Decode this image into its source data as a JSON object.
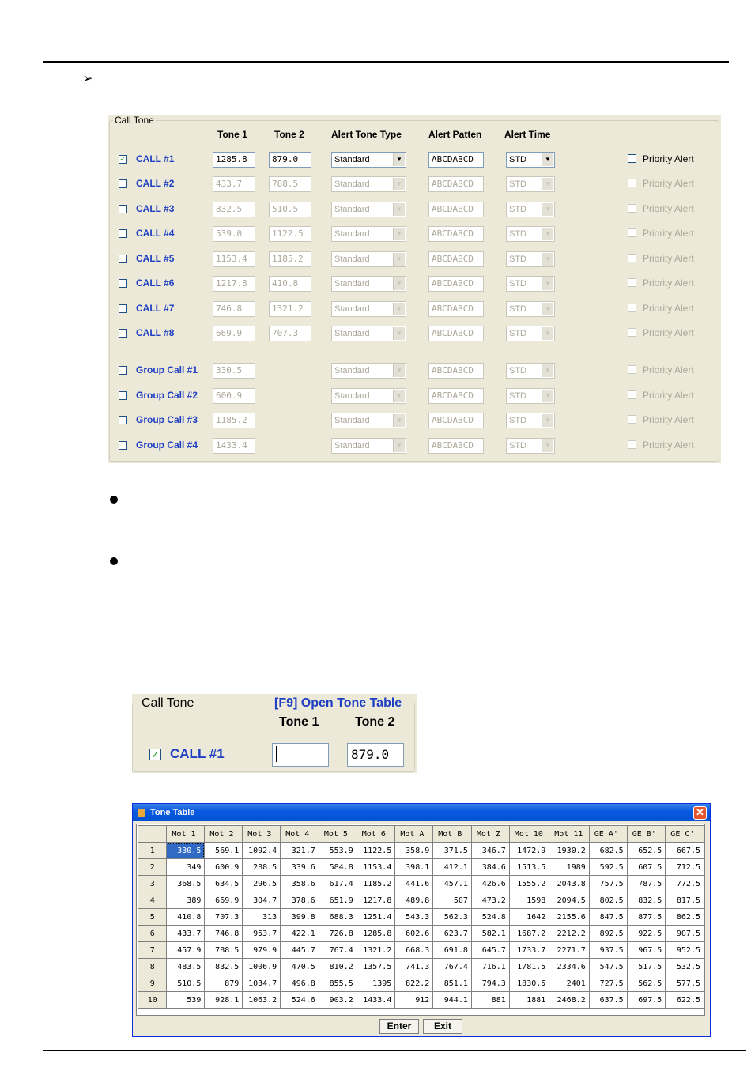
{
  "panel1": {
    "group_title": "Call Tone",
    "columns": [
      "Tone 1",
      "Tone 2",
      "Alert Tone Type",
      "Alert Patten",
      "Alert Time"
    ],
    "rows": [
      {
        "label": "CALL #1",
        "checked": true,
        "tone1": "1285.8",
        "tone2": "879.0",
        "type": "Standard",
        "pattern": "ABCDABCD",
        "time": "STD",
        "priority": "Priority Alert",
        "enabled": true
      },
      {
        "label": "CALL #2",
        "checked": false,
        "tone1": "433.7",
        "tone2": "788.5",
        "type": "Standard",
        "pattern": "ABCDABCD",
        "time": "STD",
        "priority": "Priority Alert",
        "enabled": false
      },
      {
        "label": "CALL #3",
        "checked": false,
        "tone1": "832.5",
        "tone2": "510.5",
        "type": "Standard",
        "pattern": "ABCDABCD",
        "time": "STD",
        "priority": "Priority Alert",
        "enabled": false
      },
      {
        "label": "CALL #4",
        "checked": false,
        "tone1": "539.0",
        "tone2": "1122.5",
        "type": "Standard",
        "pattern": "ABCDABCD",
        "time": "STD",
        "priority": "Priority Alert",
        "enabled": false
      },
      {
        "label": "CALL #5",
        "checked": false,
        "tone1": "1153.4",
        "tone2": "1185.2",
        "type": "Standard",
        "pattern": "ABCDABCD",
        "time": "STD",
        "priority": "Priority Alert",
        "enabled": false
      },
      {
        "label": "CALL #6",
        "checked": false,
        "tone1": "1217.8",
        "tone2": "410.8",
        "type": "Standard",
        "pattern": "ABCDABCD",
        "time": "STD",
        "priority": "Priority Alert",
        "enabled": false
      },
      {
        "label": "CALL #7",
        "checked": false,
        "tone1": "746.8",
        "tone2": "1321.2",
        "type": "Standard",
        "pattern": "ABCDABCD",
        "time": "STD",
        "priority": "Priority Alert",
        "enabled": false
      },
      {
        "label": "CALL #8",
        "checked": false,
        "tone1": "669.9",
        "tone2": "707.3",
        "type": "Standard",
        "pattern": "ABCDABCD",
        "time": "STD",
        "priority": "Priority Alert",
        "enabled": false
      }
    ],
    "group_rows": [
      {
        "label": "Group Call #1",
        "checked": false,
        "tone1": "330.5",
        "type": "Standard",
        "pattern": "ABCDABCD",
        "time": "STD",
        "priority": "Priority Alert"
      },
      {
        "label": "Group Call #2",
        "checked": false,
        "tone1": "600.9",
        "type": "Standard",
        "pattern": "ABCDABCD",
        "time": "STD",
        "priority": "Priority Alert"
      },
      {
        "label": "Group Call #3",
        "checked": false,
        "tone1": "1185.2",
        "type": "Standard",
        "pattern": "ABCDABCD",
        "time": "STD",
        "priority": "Priority Alert"
      },
      {
        "label": "Group Call #4",
        "checked": false,
        "tone1": "1433.4",
        "type": "Standard",
        "pattern": "ABCDABCD",
        "time": "STD",
        "priority": "Priority Alert"
      }
    ]
  },
  "panel2": {
    "group_title": "Call Tone",
    "hint": "[F9] Open Tone Table",
    "col1": "Tone 1",
    "col2": "Tone 2",
    "row_label": "CALL #1",
    "tone1": "",
    "tone2": "879.0"
  },
  "tone_table": {
    "window_title": "Tone Table",
    "close_icon": "close-icon",
    "headers": [
      "Mot 1",
      "Mot 2",
      "Mot 3",
      "Mot 4",
      "Mot 5",
      "Mot 6",
      "Mot A",
      "Mot B",
      "Mot Z",
      "Mot 10",
      "Mot 11",
      "GE A'",
      "GE B'",
      "GE C'"
    ],
    "rows": [
      [
        "330.5",
        "569.1",
        "1092.4",
        "321.7",
        "553.9",
        "1122.5",
        "358.9",
        "371.5",
        "346.7",
        "1472.9",
        "1930.2",
        "682.5",
        "652.5",
        "667.5"
      ],
      [
        "349",
        "600.9",
        "288.5",
        "339.6",
        "584.8",
        "1153.4",
        "398.1",
        "412.1",
        "384.6",
        "1513.5",
        "1989",
        "592.5",
        "607.5",
        "712.5"
      ],
      [
        "368.5",
        "634.5",
        "296.5",
        "358.6",
        "617.4",
        "1185.2",
        "441.6",
        "457.1",
        "426.6",
        "1555.2",
        "2043.8",
        "757.5",
        "787.5",
        "772.5"
      ],
      [
        "389",
        "669.9",
        "304.7",
        "378.6",
        "651.9",
        "1217.8",
        "489.8",
        "507",
        "473.2",
        "1598",
        "2094.5",
        "802.5",
        "832.5",
        "817.5"
      ],
      [
        "410.8",
        "707.3",
        "313",
        "399.8",
        "688.3",
        "1251.4",
        "543.3",
        "562.3",
        "524.8",
        "1642",
        "2155.6",
        "847.5",
        "877.5",
        "862.5"
      ],
      [
        "433.7",
        "746.8",
        "953.7",
        "422.1",
        "726.8",
        "1285.8",
        "602.6",
        "623.7",
        "582.1",
        "1687.2",
        "2212.2",
        "892.5",
        "922.5",
        "907.5"
      ],
      [
        "457.9",
        "788.5",
        "979.9",
        "445.7",
        "767.4",
        "1321.2",
        "668.3",
        "691.8",
        "645.7",
        "1733.7",
        "2271.7",
        "937.5",
        "967.5",
        "952.5"
      ],
      [
        "483.5",
        "832.5",
        "1006.9",
        "470.5",
        "810.2",
        "1357.5",
        "741.3",
        "767.4",
        "716.1",
        "1781.5",
        "2334.6",
        "547.5",
        "517.5",
        "532.5"
      ],
      [
        "510.5",
        "879",
        "1034.7",
        "496.8",
        "855.5",
        "1395",
        "822.2",
        "851.1",
        "794.3",
        "1830.5",
        "2401",
        "727.5",
        "562.5",
        "577.5"
      ],
      [
        "539",
        "928.1",
        "1063.2",
        "524.6",
        "903.2",
        "1433.4",
        "912",
        "944.1",
        "881",
        "1881",
        "2468.2",
        "637.5",
        "697.5",
        "622.5"
      ]
    ],
    "row_numbers": [
      "1",
      "2",
      "3",
      "4",
      "5",
      "6",
      "7",
      "8",
      "9",
      "10"
    ],
    "enter_label": "Enter",
    "exit_label": "Exit"
  }
}
